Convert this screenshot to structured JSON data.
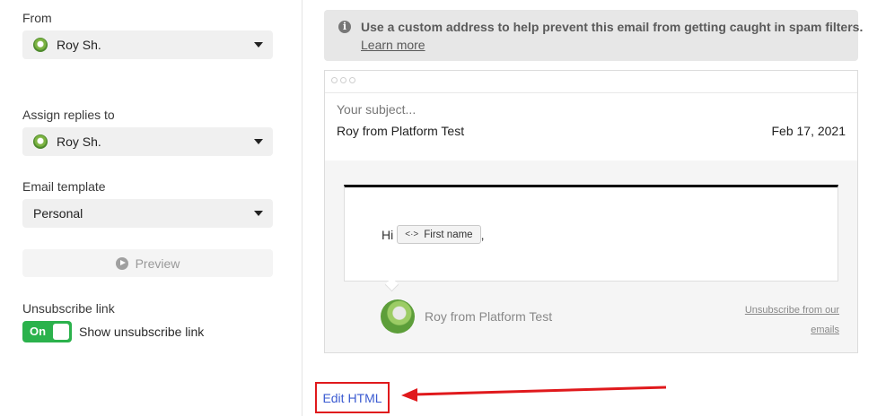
{
  "sidebar": {
    "from_label": "From",
    "from_value": "Roy Sh.",
    "assign_label": "Assign replies to",
    "assign_value": "Roy Sh.",
    "template_label": "Email template",
    "template_value": "Personal",
    "preview_label": "Preview",
    "unsubscribe_label": "Unsubscribe link",
    "toggle_state": "On",
    "toggle_text": "Show unsubscribe link"
  },
  "notice": {
    "text": "Use a custom address to help prevent this email from getting caught in spam filters.",
    "link": "Learn more"
  },
  "email": {
    "subject_placeholder": "Your subject...",
    "sender": "Roy from Platform Test",
    "date": "Feb 17, 2021",
    "greeting": "Hi",
    "merge_tag": "First name",
    "merge_icon": "<·>",
    "after_tag": ",",
    "signature_name": "Roy from Platform Test",
    "unsubscribe_line1": "Unsubscribe from our",
    "unsubscribe_line2": "emails"
  },
  "footer": {
    "edit_html": "Edit HTML"
  },
  "colors": {
    "toggle_on": "#2bb24c",
    "highlight": "#e0191c",
    "link": "#3b5bd1"
  }
}
